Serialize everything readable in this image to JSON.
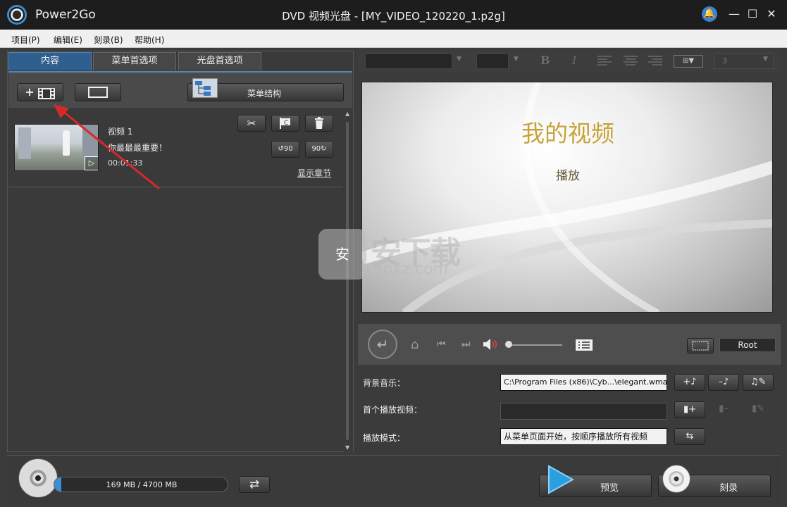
{
  "app": {
    "name": "Power2Go",
    "title": "DVD 视频光盘 - [MY_VIDEO_120220_1.p2g]"
  },
  "menu": [
    "项目(P)",
    "编辑(E)",
    "刻录(B)",
    "帮助(H)"
  ],
  "tabs": [
    "内容",
    "菜单首选项",
    "光盘首选项"
  ],
  "toolbar": {
    "add_video_icon": "+",
    "menu_structure": "菜单结构"
  },
  "item": {
    "title": "视频 1",
    "subtitle": "你最最最重要！",
    "duration": "00:01:33",
    "show_chapters": "显示章节"
  },
  "rotate": {
    "left": "90",
    "right": "90"
  },
  "format": {
    "bold": "B",
    "italic": "I",
    "number": "3"
  },
  "preview": {
    "title": "我的视频",
    "play": "播放"
  },
  "watermark": {
    "text": "安下载",
    "url": "anxz.com"
  },
  "root_label": "Root",
  "settings": {
    "bg_music_label": "背景音乐：",
    "bg_music_value": "C:\\Program Files (x86)\\Cyb...\\elegant.wma",
    "first_play_label": "首个播放视频：",
    "first_play_value": "",
    "play_mode_label": "播放模式：",
    "play_mode_value": "从菜单页面开始，按顺序播放所有视频"
  },
  "bottom": {
    "capacity": "169 MB / 4700 MB",
    "capacity_fraction": 0.036,
    "preview_label": "预览",
    "burn_label": "刻录"
  },
  "colors": {
    "title_gold": "#c8a33a",
    "accent_blue": "#3a8fd6",
    "arrow_red": "#d42a2a"
  }
}
